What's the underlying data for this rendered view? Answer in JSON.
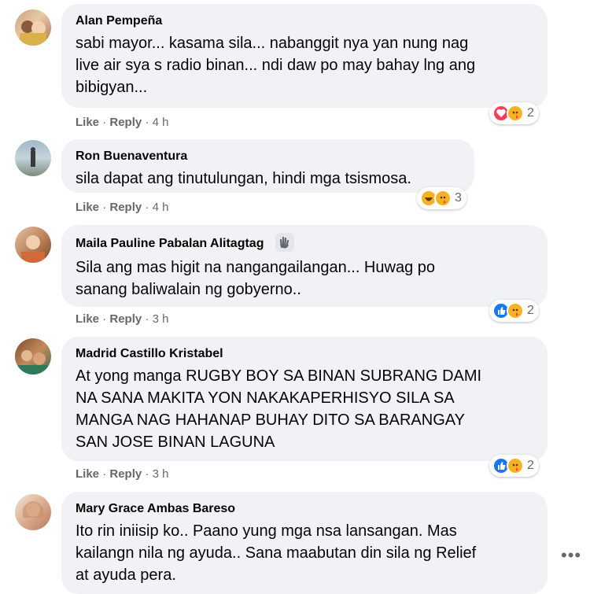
{
  "comments": [
    {
      "author": "Alan Pempeña",
      "lines": [
        "sabi mayor... kasama sila... nabanggit nya yan nung nag",
        "live air sya s radio binan... ndi daw po may bahay lng ang",
        "bibigyan..."
      ],
      "like": "Like",
      "reply": "Reply",
      "time": "4 h",
      "reaction_count": "2",
      "reactions": [
        "heart",
        "care"
      ]
    },
    {
      "author": "Ron Buenaventura",
      "lines": [
        "sila dapat ang tinutulungan, hindi mga tsismosa."
      ],
      "like": "Like",
      "reply": "Reply",
      "time": "4 h",
      "reaction_count": "3",
      "reactions": [
        "haha",
        "care"
      ]
    },
    {
      "author": "Maila Pauline Pabalan Alitagtag",
      "lines": [
        "Sila ang mas higit na nangangailangan... Huwag po",
        "sanang baliwalain ng gobyerno.."
      ],
      "like": "Like",
      "reply": "Reply",
      "time": "3 h",
      "reaction_count": "2",
      "reactions": [
        "like",
        "care"
      ]
    },
    {
      "author": "Madrid Castillo Kristabel",
      "lines": [
        "At yong manga RUGBY BOY SA BINAN SUBRANG DAMI",
        "NA SANA MAKITA YON NAKAKAPERHISYO SILA SA",
        "MANGA NAG HAHANAP BUHAY DITO SA BARANGAY",
        "SAN JOSE BINAN LAGUNA"
      ],
      "like": "Like",
      "reply": "Reply",
      "time": "3 h",
      "reaction_count": "2",
      "reactions": [
        "like",
        "care"
      ]
    },
    {
      "author": "Mary Grace Ambas Bareso",
      "lines": [
        "Ito rin iniisip ko.. Paano yung mga nsa lansangan. Mas",
        "kailangn nila ng ayuda.. Sana maabutan din sila ng Relief",
        "at ayuda pera."
      ]
    }
  ],
  "separator": "·",
  "more_icon": "•••",
  "icons": {
    "badge": "wave-hand-icon",
    "more": "more-options-icon"
  },
  "colors": {
    "bubble": "#f0f2f5",
    "meta": "#65676b",
    "like_blue": "#1877f2",
    "heart_red": "#f33e58",
    "care_yellow": "#f7b125"
  }
}
